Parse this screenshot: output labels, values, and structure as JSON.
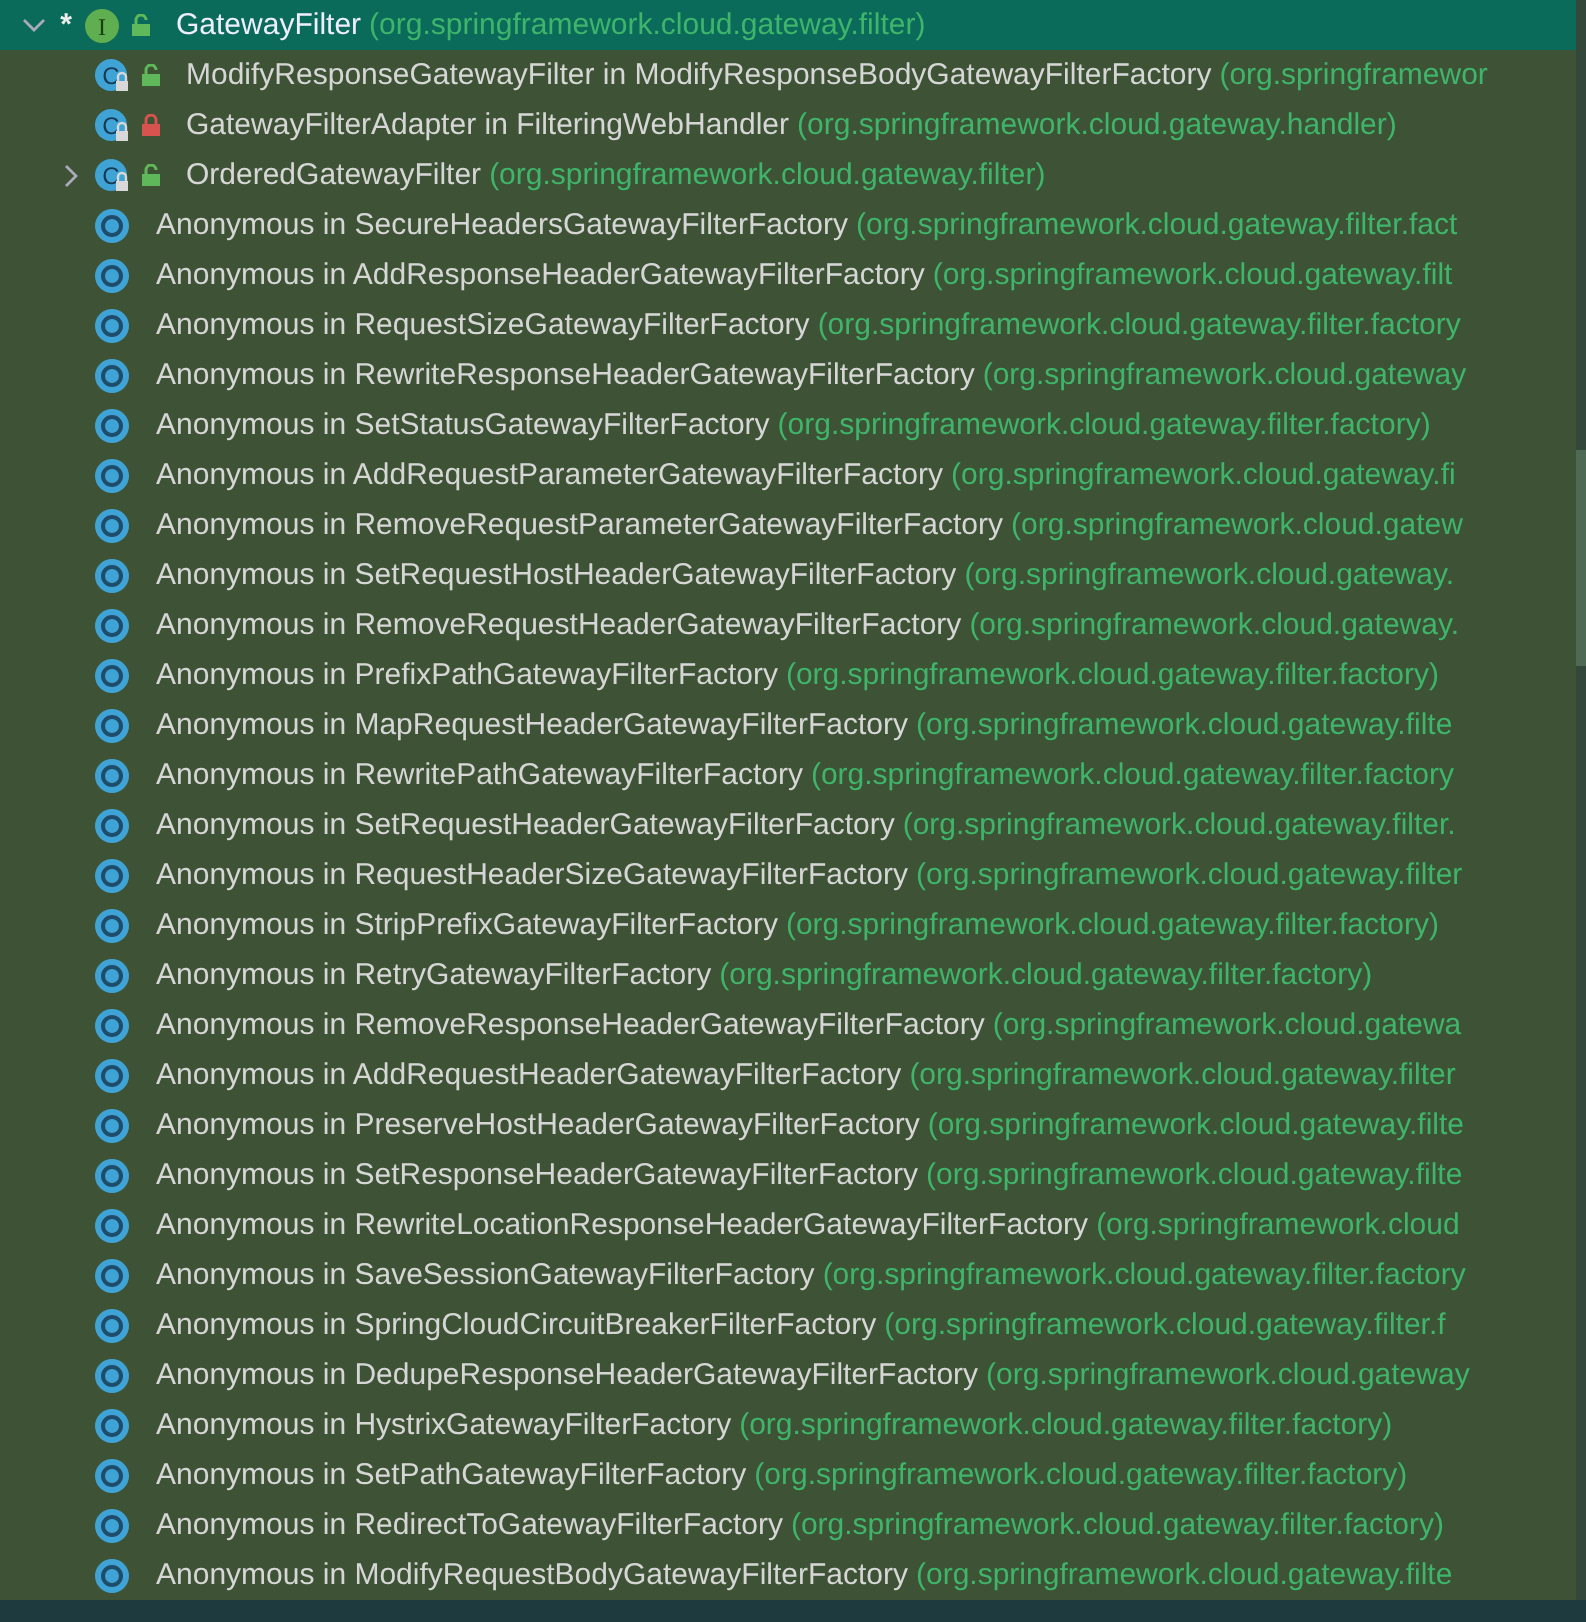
{
  "tree": {
    "root": {
      "mark": "*",
      "kind": "interface",
      "letter": "I",
      "private": false,
      "label": "GatewayFilter",
      "package": "(org.springframework.cloud.gateway.filter)",
      "expanded": true,
      "selected": true,
      "children": [
        {
          "kind": "class",
          "letter": "C",
          "private": false,
          "label": "ModifyResponseGatewayFilter in ModifyResponseBodyGatewayFilterFactory",
          "package": "(org.springframewor",
          "selected": false
        },
        {
          "kind": "class",
          "letter": "C",
          "private": true,
          "label": "GatewayFilterAdapter in FilteringWebHandler",
          "package": "(org.springframework.cloud.gateway.handler)",
          "selected": false
        },
        {
          "kind": "class",
          "letter": "C",
          "private": false,
          "label": "OrderedGatewayFilter",
          "package": "(org.springframework.cloud.gateway.filter)",
          "expanded": false,
          "selected": false
        },
        {
          "kind": "anonymous",
          "label": "Anonymous in SecureHeadersGatewayFilterFactory",
          "package": "(org.springframework.cloud.gateway.filter.fact",
          "selected": false
        },
        {
          "kind": "anonymous",
          "label": "Anonymous in AddResponseHeaderGatewayFilterFactory",
          "package": "(org.springframework.cloud.gateway.filt",
          "selected": false
        },
        {
          "kind": "anonymous",
          "label": "Anonymous in RequestSizeGatewayFilterFactory",
          "package": "(org.springframework.cloud.gateway.filter.factory",
          "selected": false
        },
        {
          "kind": "anonymous",
          "label": "Anonymous in RewriteResponseHeaderGatewayFilterFactory",
          "package": "(org.springframework.cloud.gateway",
          "selected": false
        },
        {
          "kind": "anonymous",
          "label": "Anonymous in SetStatusGatewayFilterFactory",
          "package": "(org.springframework.cloud.gateway.filter.factory)",
          "selected": false
        },
        {
          "kind": "anonymous",
          "label": "Anonymous in AddRequestParameterGatewayFilterFactory",
          "package": "(org.springframework.cloud.gateway.fi",
          "selected": false
        },
        {
          "kind": "anonymous",
          "label": "Anonymous in RemoveRequestParameterGatewayFilterFactory",
          "package": "(org.springframework.cloud.gatew",
          "selected": false
        },
        {
          "kind": "anonymous",
          "label": "Anonymous in SetRequestHostHeaderGatewayFilterFactory",
          "package": "(org.springframework.cloud.gateway.",
          "selected": false
        },
        {
          "kind": "anonymous",
          "label": "Anonymous in RemoveRequestHeaderGatewayFilterFactory",
          "package": "(org.springframework.cloud.gateway.",
          "selected": false
        },
        {
          "kind": "anonymous",
          "label": "Anonymous in PrefixPathGatewayFilterFactory",
          "package": "(org.springframework.cloud.gateway.filter.factory)",
          "selected": false
        },
        {
          "kind": "anonymous",
          "label": "Anonymous in MapRequestHeaderGatewayFilterFactory",
          "package": "(org.springframework.cloud.gateway.filte",
          "selected": false
        },
        {
          "kind": "anonymous",
          "label": "Anonymous in RewritePathGatewayFilterFactory",
          "package": "(org.springframework.cloud.gateway.filter.factory",
          "selected": false
        },
        {
          "kind": "anonymous",
          "label": "Anonymous in SetRequestHeaderGatewayFilterFactory",
          "package": "(org.springframework.cloud.gateway.filter.",
          "selected": false
        },
        {
          "kind": "anonymous",
          "label": "Anonymous in RequestHeaderSizeGatewayFilterFactory",
          "package": "(org.springframework.cloud.gateway.filter",
          "selected": false
        },
        {
          "kind": "anonymous",
          "label": "Anonymous in StripPrefixGatewayFilterFactory",
          "package": "(org.springframework.cloud.gateway.filter.factory)",
          "selected": false
        },
        {
          "kind": "anonymous",
          "label": "Anonymous in RetryGatewayFilterFactory",
          "package": "(org.springframework.cloud.gateway.filter.factory)",
          "selected": false
        },
        {
          "kind": "anonymous",
          "label": "Anonymous in RemoveResponseHeaderGatewayFilterFactory",
          "package": "(org.springframework.cloud.gatewa",
          "selected": false
        },
        {
          "kind": "anonymous",
          "label": "Anonymous in AddRequestHeaderGatewayFilterFactory",
          "package": "(org.springframework.cloud.gateway.filter",
          "selected": false
        },
        {
          "kind": "anonymous",
          "label": "Anonymous in PreserveHostHeaderGatewayFilterFactory",
          "package": "(org.springframework.cloud.gateway.filte",
          "selected": false
        },
        {
          "kind": "anonymous",
          "label": "Anonymous in SetResponseHeaderGatewayFilterFactory",
          "package": "(org.springframework.cloud.gateway.filte",
          "selected": false
        },
        {
          "kind": "anonymous",
          "label": "Anonymous in RewriteLocationResponseHeaderGatewayFilterFactory",
          "package": "(org.springframework.cloud",
          "selected": false
        },
        {
          "kind": "anonymous",
          "label": "Anonymous in SaveSessionGatewayFilterFactory",
          "package": "(org.springframework.cloud.gateway.filter.factory",
          "selected": false
        },
        {
          "kind": "anonymous",
          "label": "Anonymous in SpringCloudCircuitBreakerFilterFactory",
          "package": "(org.springframework.cloud.gateway.filter.f",
          "selected": false
        },
        {
          "kind": "anonymous",
          "label": "Anonymous in DedupeResponseHeaderGatewayFilterFactory",
          "package": "(org.springframework.cloud.gateway",
          "selected": false
        },
        {
          "kind": "anonymous",
          "label": "Anonymous in HystrixGatewayFilterFactory",
          "package": "(org.springframework.cloud.gateway.filter.factory)",
          "selected": false
        },
        {
          "kind": "anonymous",
          "label": "Anonymous in SetPathGatewayFilterFactory",
          "package": "(org.springframework.cloud.gateway.filter.factory)",
          "selected": false
        },
        {
          "kind": "anonymous",
          "label": "Anonymous in RedirectToGatewayFilterFactory",
          "package": "(org.springframework.cloud.gateway.filter.factory)",
          "selected": false
        },
        {
          "kind": "anonymous",
          "label": "Anonymous in ModifyRequestBodyGatewayFilterFactory",
          "package": "(org.springframework.cloud.gateway.filte",
          "selected": false
        }
      ]
    }
  }
}
